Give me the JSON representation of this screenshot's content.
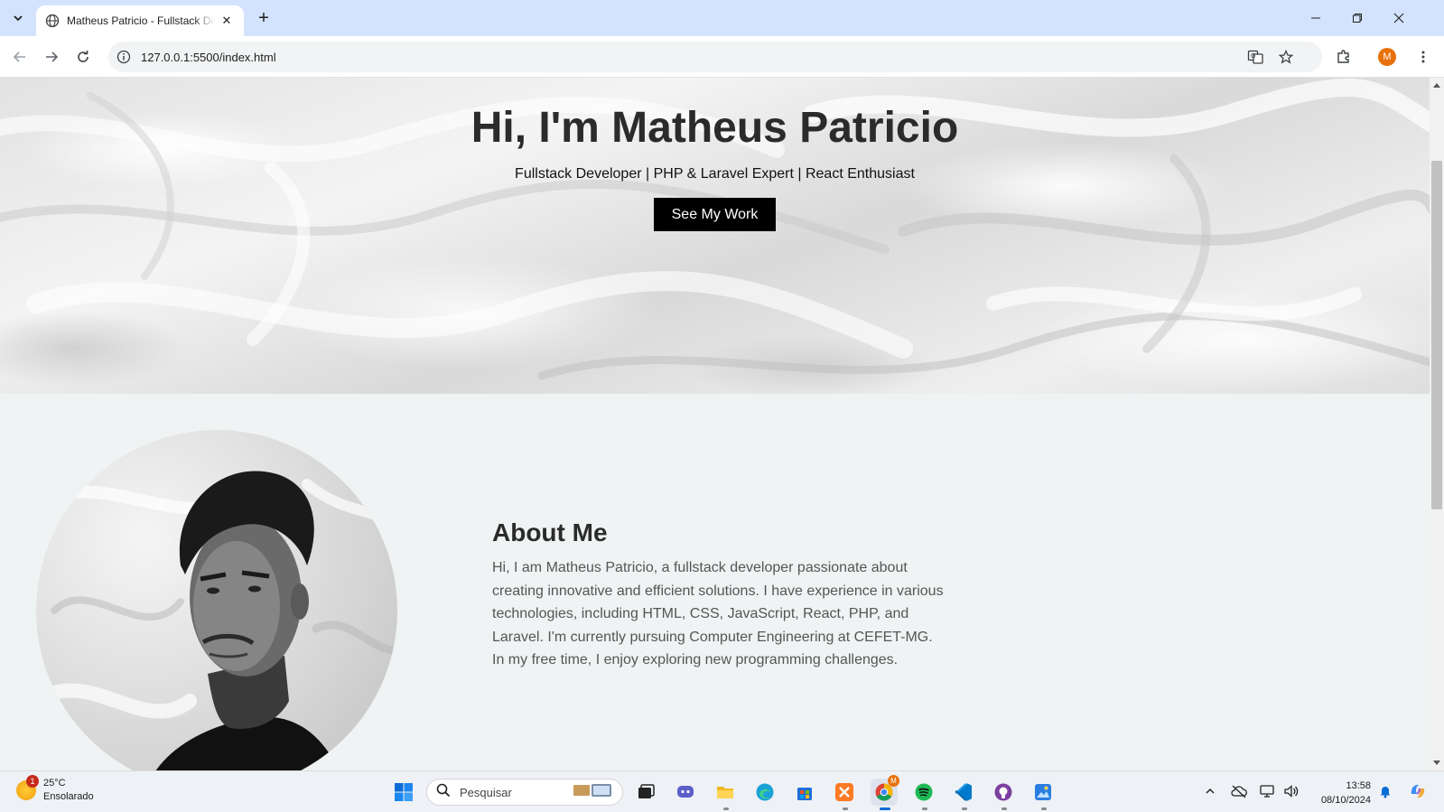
{
  "browser": {
    "tab_title": "Matheus Patricio - Fullstack Developer",
    "url": "127.0.0.1:5500/index.html",
    "profile_initial": "M"
  },
  "hero": {
    "title": "Hi, I'm Matheus Patricio",
    "subtitle": "Fullstack Developer | PHP & Laravel Expert | React Enthusiast",
    "cta_label": "See My Work"
  },
  "about": {
    "title": "About Me",
    "text": "Hi, I am Matheus Patricio, a fullstack developer passionate about creating innovative and efficient solutions. I have experience in various technologies, including HTML, CSS, JavaScript, React, PHP, and Laravel. I'm currently pursuing Computer Engineering at CEFET-MG. In my free time, I enjoy exploring new programming challenges."
  },
  "taskbar": {
    "weather_temp": "25°C",
    "weather_desc": "Ensolarado",
    "weather_badge": "1",
    "search_placeholder": "Pesquisar",
    "time": "13:58",
    "date": "08/10/2024",
    "chrome_badge": "M"
  },
  "colors": {
    "browser_tabstrip": "#d3e3fd",
    "accent_profile": "#e8710a",
    "cta_bg": "#000000",
    "section_bg": "#f0f3f4"
  }
}
